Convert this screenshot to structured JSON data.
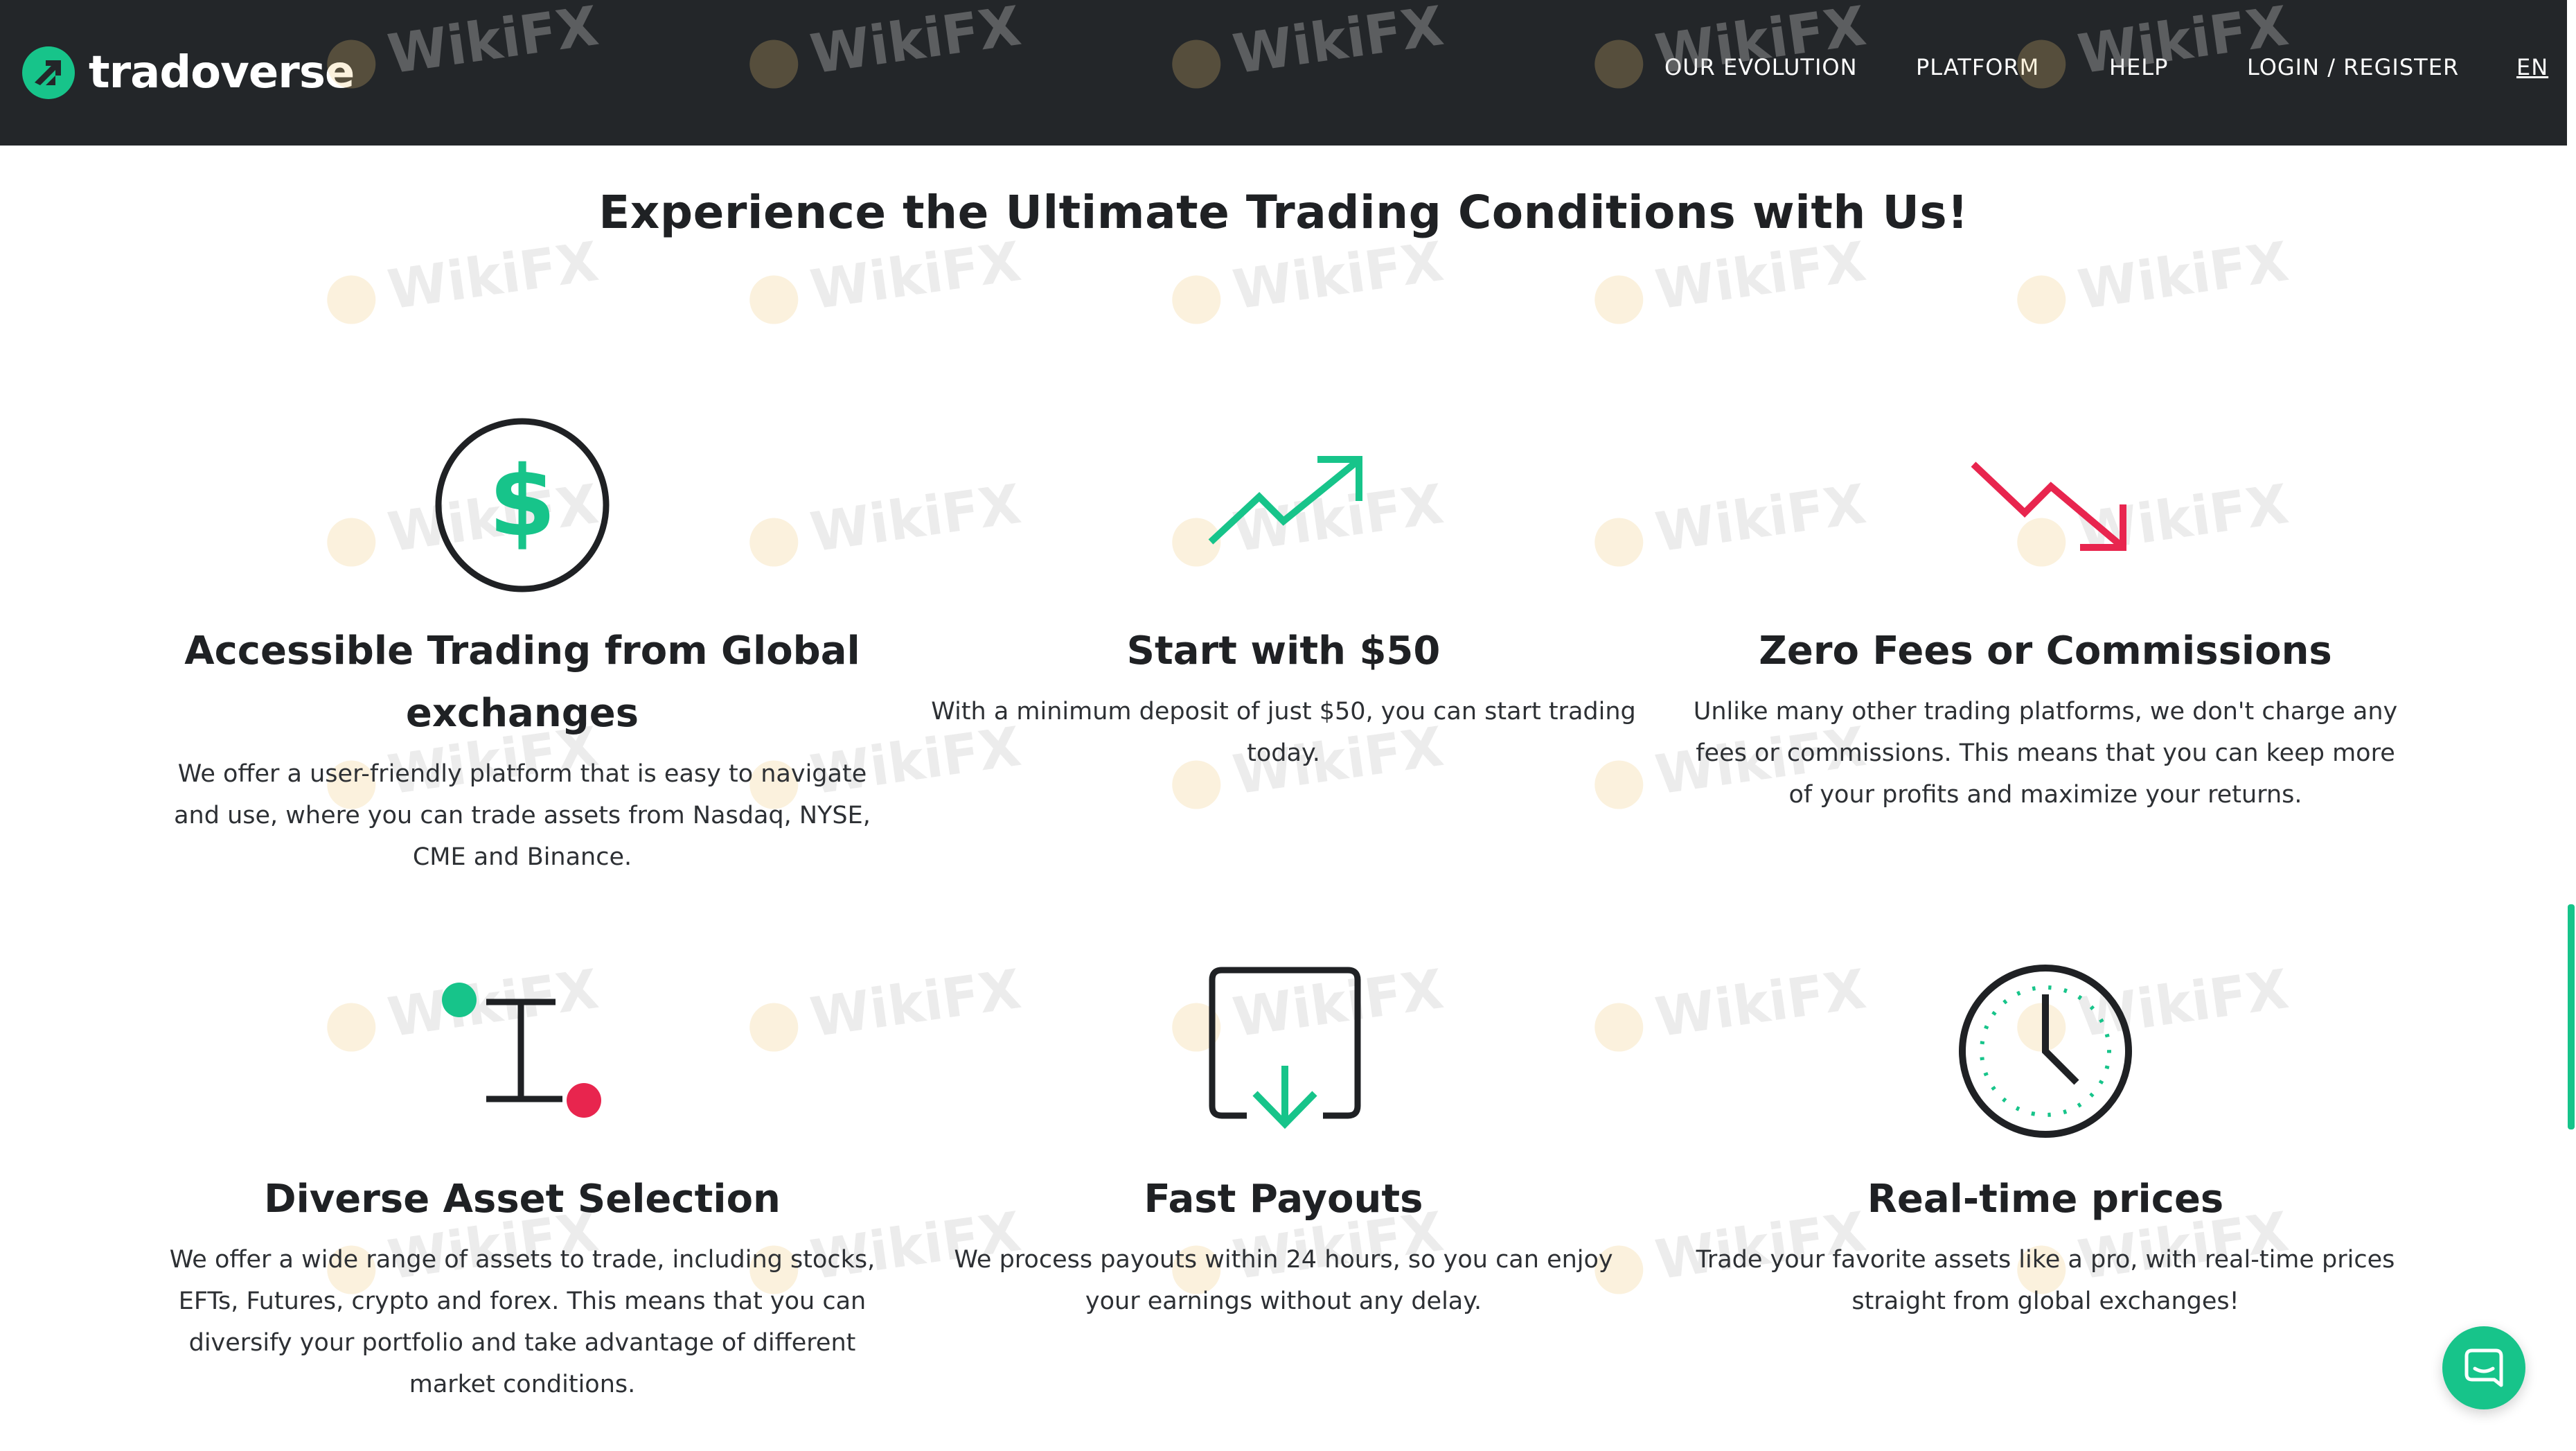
{
  "brand": {
    "name": "tradoverse",
    "accent": "#17c48a",
    "red": "#e8254e",
    "dark": "#232629"
  },
  "nav": {
    "items": [
      "OUR EVOLUTION",
      "PLATFORM",
      "HELP",
      "LOGIN / REGISTER"
    ],
    "language": "EN"
  },
  "section_title": "Experience the Ultimate Trading Conditions with Us!",
  "features": [
    {
      "icon": "dollar-circle-icon",
      "title": "Accessible Trading from Global exchanges",
      "text": "We offer a user-friendly platform that is easy to navigate and use, where you can trade assets from Nasdaq, NYSE, CME and Binance."
    },
    {
      "icon": "trend-up-icon",
      "title": "Start with $50",
      "text": "With a minimum deposit of just $50, you can start trading today."
    },
    {
      "icon": "trend-down-icon",
      "title": "Zero Fees or Commissions",
      "text": "Unlike many other trading platforms, we don't charge any fees or commissions. This means that you can keep more of your profits and maximize your returns."
    },
    {
      "icon": "asset-range-icon",
      "title": "Diverse Asset Selection",
      "text": "We offer a wide range of assets to trade, including stocks, EFTs, Futures, crypto and forex. This means that you can diversify your portfolio and take advantage of different market conditions."
    },
    {
      "icon": "download-tray-icon",
      "title": "Fast Payouts",
      "text": "We process payouts within 24 hours, so you can enjoy your earnings without any delay."
    },
    {
      "icon": "clock-icon",
      "title": "Real-time prices",
      "text": "Trade your favorite assets like a pro, with real-time prices straight from global exchanges!"
    }
  ],
  "watermark": "WikiFX",
  "chat": {
    "icon": "chat-bubble-icon"
  }
}
